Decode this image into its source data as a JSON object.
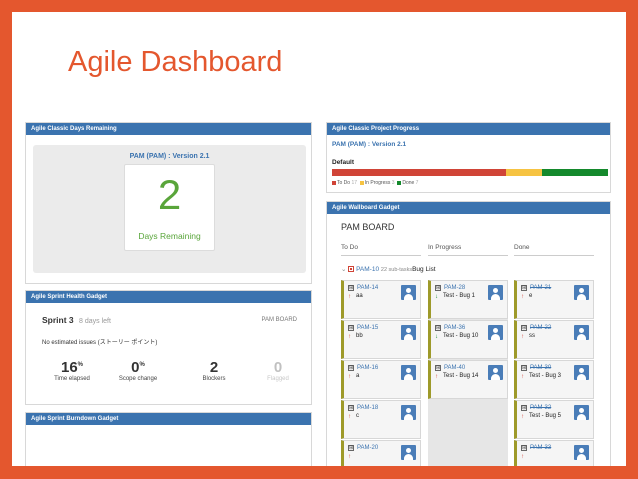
{
  "slide": {
    "title": "Agile Dashboard"
  },
  "days_remaining": {
    "header": "Agile Classic Days Remaining",
    "version": "PAM (PAM) : Version 2.1",
    "days": "2",
    "label": "Days Remaining"
  },
  "sprint_health": {
    "header": "Agile Sprint Health Gadget",
    "sprint": "Sprint 3",
    "days_left": "8 days left",
    "board": "PAM BOARD",
    "estimation_note": "No estimated issues (ストーリー ポイント)",
    "stats": [
      {
        "value": "16",
        "unit": "%",
        "label": "Time elapsed"
      },
      {
        "value": "0",
        "unit": "%",
        "label": "Scope change"
      },
      {
        "value": "2",
        "unit": "",
        "label": "Blockers"
      },
      {
        "value": "0",
        "unit": "",
        "label": "Flagged"
      }
    ]
  },
  "burndown": {
    "header": "Agile Sprint Burndown Gadget"
  },
  "project_progress": {
    "header": "Agile Classic Project Progress",
    "version": "PAM (PAM) : Version 2.1",
    "label": "Default",
    "segments": [
      {
        "name": "To Do",
        "count": "17",
        "fraction": 0.63,
        "color": "#d04437"
      },
      {
        "name": "In Progress",
        "count": "3",
        "fraction": 0.13,
        "color": "#f6c342"
      },
      {
        "name": "Done",
        "count": "7",
        "fraction": 0.24,
        "color": "#14892c"
      }
    ]
  },
  "wallboard": {
    "header": "Agile Wallboard Gadget",
    "board_title": "PAM BOARD",
    "columns": [
      "To Do",
      "In Progress",
      "Done"
    ],
    "swimlane": {
      "key": "PAM-10",
      "subtasks": "22 sub-tasks",
      "summary": "Bug List"
    },
    "cards": [
      [
        {
          "key": "PAM-14",
          "summary": "aa",
          "priority": "up"
        },
        {
          "key": "PAM-15",
          "summary": "bb",
          "priority": "up"
        },
        {
          "key": "PAM-16",
          "summary": "a",
          "priority": "up"
        },
        {
          "key": "PAM-18",
          "summary": "c",
          "priority": "up"
        },
        {
          "key": "PAM-20",
          "summary": "",
          "priority": "up"
        }
      ],
      [
        {
          "key": "PAM-28",
          "summary": "Test - Bug 1",
          "priority": "down"
        },
        {
          "key": "PAM-36",
          "summary": "Test - Bug 10",
          "priority": "down"
        },
        {
          "key": "PAM-40",
          "summary": "Test - Bug 14",
          "priority": "up"
        }
      ],
      [
        {
          "key": "PAM-21",
          "summary": "e",
          "priority": "up"
        },
        {
          "key": "PAM-22",
          "summary": "ss",
          "priority": "up"
        },
        {
          "key": "PAM-30",
          "summary": "Test - Bug 3",
          "priority": "up"
        },
        {
          "key": "PAM-32",
          "summary": "Test - Bug 5",
          "priority": "up"
        },
        {
          "key": "PAM-33",
          "summary": "",
          "priority": "up"
        }
      ]
    ]
  }
}
